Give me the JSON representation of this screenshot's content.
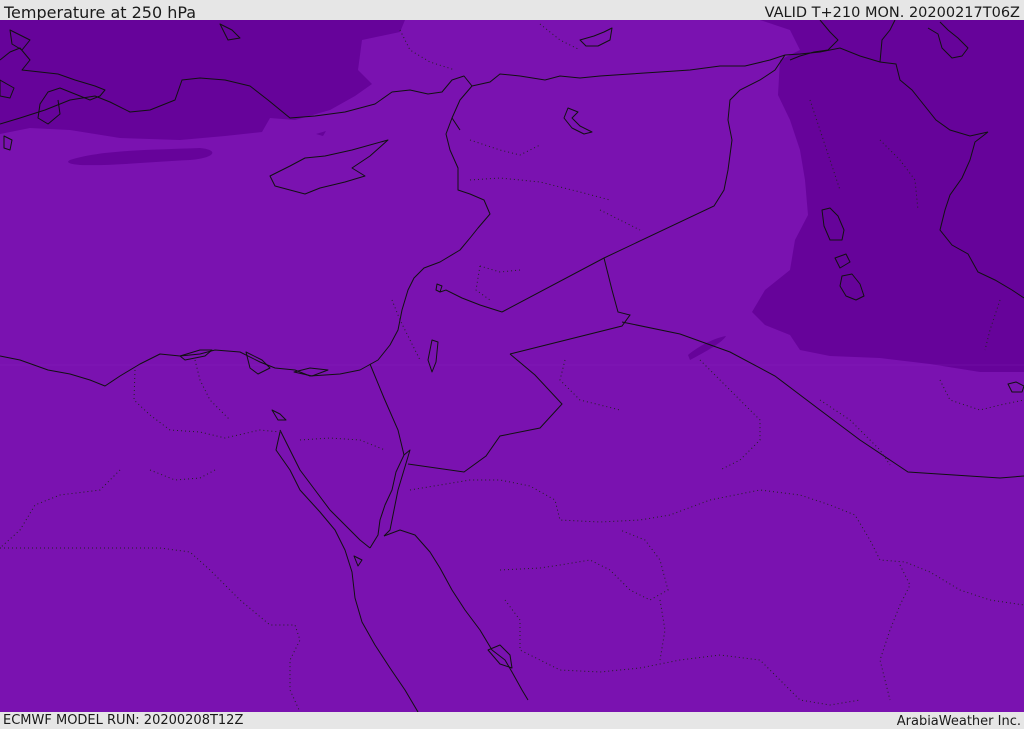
{
  "header": {
    "title": "Temperature at 250 hPa",
    "valid": "VALID T+210 MON. 20200217T06Z"
  },
  "footer": {
    "model_run": "ECMWF MODEL RUN: 20200208T12Z",
    "credit": "ArabiaWeather Inc."
  },
  "map": {
    "colors": {
      "base_field": "#7a12b0",
      "cold_field": "#66039a",
      "title_background": "#e6e6e6"
    }
  }
}
